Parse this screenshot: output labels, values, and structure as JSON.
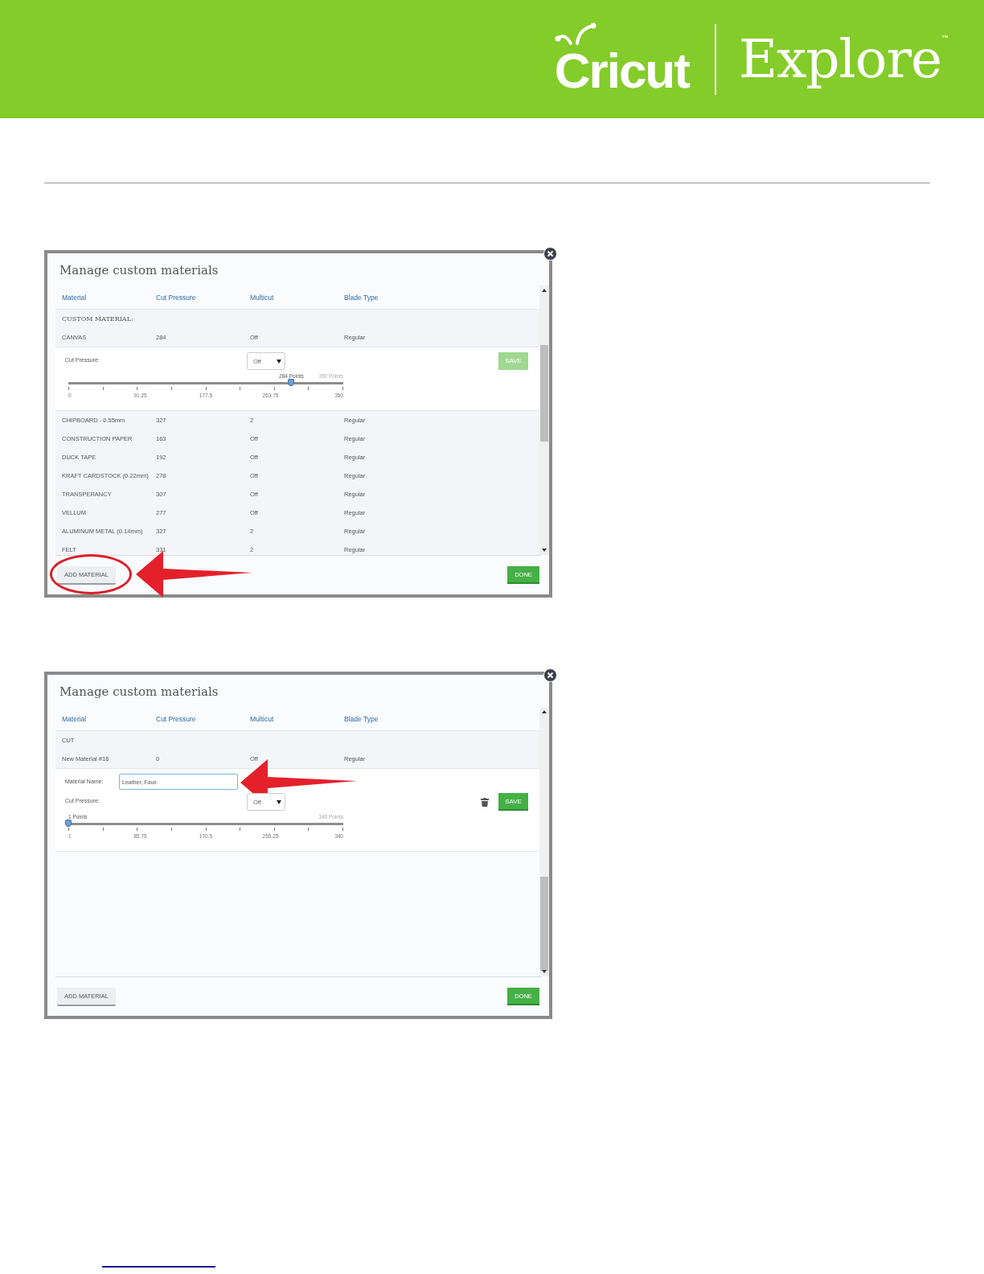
{
  "header": {
    "brand": "Cricut",
    "product": "Explore",
    "trademark": "™"
  },
  "dialogs": [
    {
      "title": "Manage custom materials",
      "columns": [
        "Material",
        "Cut Pressure",
        "Multicut",
        "Blade Type"
      ],
      "rows": [
        {
          "kind": "section",
          "material": "CUSTOM MATERIAL:"
        },
        {
          "kind": "row",
          "material": "CANVAS",
          "cut_pressure": "284",
          "multicut": "Off",
          "blade_type": "Regular",
          "editor": {
            "pressure_label": "Cut Pressure:",
            "multicut": "Off",
            "save": "SAVE",
            "save_enabled": false,
            "delete": false,
            "slider": {
              "level": 0.81,
              "value_label": "284 Points",
              "max_label": "350 Points",
              "ticks": [
                "0",
                "91.25",
                "177.5",
                "263.75",
                "350"
              ]
            }
          }
        },
        {
          "kind": "row",
          "material": "CHIPBOARD - 0.55mm",
          "cut_pressure": "327",
          "multicut": "2",
          "blade_type": "Regular"
        },
        {
          "kind": "row",
          "material": "CONSTRUCTION PAPER",
          "cut_pressure": "163",
          "multicut": "Off",
          "blade_type": "Regular"
        },
        {
          "kind": "row",
          "material": "DUCK TAPE",
          "cut_pressure": "192",
          "multicut": "Off",
          "blade_type": "Regular"
        },
        {
          "kind": "row",
          "material": "KRAFT CARDSTOCK (0.22mm)",
          "cut_pressure": "278",
          "multicut": "Off",
          "blade_type": "Regular"
        },
        {
          "kind": "row",
          "material": "TRANSPERANCY",
          "cut_pressure": "307",
          "multicut": "Off",
          "blade_type": "Regular"
        },
        {
          "kind": "row",
          "material": "VELLUM",
          "cut_pressure": "277",
          "multicut": "Off",
          "blade_type": "Regular"
        },
        {
          "kind": "row",
          "material": "ALUMINUM METAL (0.14mm)",
          "cut_pressure": "327",
          "multicut": "2",
          "blade_type": "Regular"
        },
        {
          "kind": "row",
          "material": "FELT",
          "cut_pressure": "331",
          "multicut": "2",
          "blade_type": "Regular"
        }
      ],
      "footer": {
        "add": "ADD MATERIAL",
        "done": "DONE",
        "annotated": true
      }
    },
    {
      "title": "Manage custom materials",
      "columns": [
        "Material",
        "Cut Pressure",
        "Multicut",
        "Blade Type"
      ],
      "rows": [
        {
          "kind": "row",
          "material": "CUT"
        },
        {
          "kind": "row",
          "material": "New Material #16",
          "cut_pressure": "0",
          "multicut": "Off",
          "blade_type": "Regular",
          "editor": {
            "name_label": "Material Name:",
            "name_value": "Leather, Faux",
            "annotated": true,
            "pressure_label": "Cut Pressure:",
            "multicut": "Off",
            "save": "SAVE",
            "save_enabled": true,
            "delete": true,
            "slider": {
              "level": 0,
              "value_label": "1 Points",
              "max_label": "340 Points",
              "ticks": [
                "1",
                "85.75",
                "170.5",
                "255.25",
                "340"
              ]
            }
          }
        }
      ],
      "footer": {
        "add": "ADD MATERIAL",
        "done": "DONE",
        "annotated": false
      }
    }
  ]
}
